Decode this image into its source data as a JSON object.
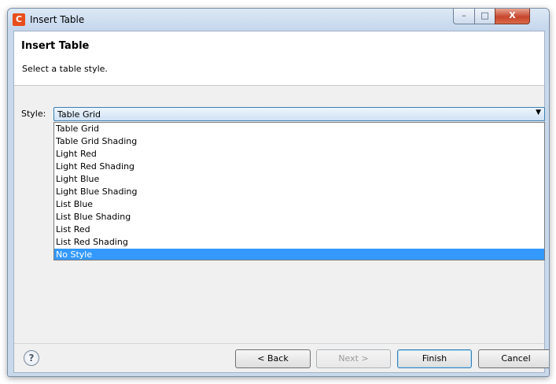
{
  "window": {
    "app_icon": "C",
    "title": "Insert Table",
    "controls": {
      "minimize": "–",
      "maximize": "□",
      "close": "X"
    }
  },
  "header": {
    "title": "Insert Table",
    "description": "Select a table style."
  },
  "style": {
    "label": "Style:",
    "selected_value": "Table Grid",
    "arrow_icon": "▼",
    "options": [
      "Table Grid",
      "Table Grid Shading",
      "Light Red",
      "Light Red Shading",
      "Light Blue",
      "Light Blue Shading",
      "List Blue",
      "List Blue Shading",
      "List Red",
      "List Red Shading",
      "No Style"
    ],
    "highlighted_option": "No Style"
  },
  "footer": {
    "help_icon": "?",
    "back_label": "< Back",
    "next_label": "Next >",
    "finish_label": "Finish",
    "cancel_label": "Cancel"
  },
  "colors": {
    "highlight": "#3399ff",
    "combo_border": "#3c7fb1",
    "window_frame": "#c9d9ec"
  }
}
